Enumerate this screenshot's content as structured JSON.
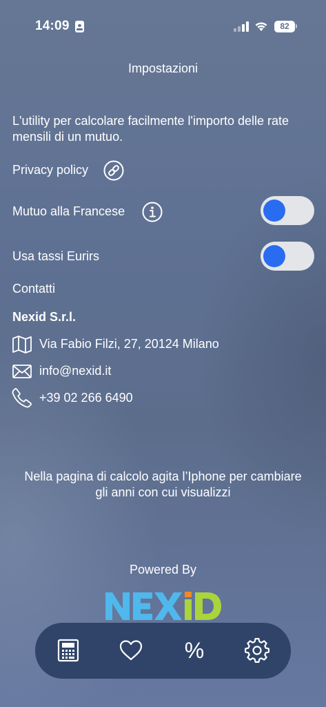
{
  "status_bar": {
    "time": "14:09",
    "battery": "82"
  },
  "header": {
    "title": "Impostazioni"
  },
  "description": "L'utility per calcolare facilmente l'importo delle rate mensili di un mutuo.",
  "settings": {
    "privacy_label": "Privacy policy",
    "francese_label": "Mutuo alla Francese",
    "francese_on": true,
    "eurirs_label": "Usa tassi Eurirs",
    "eurirs_on": true
  },
  "contacts": {
    "title": "Contatti",
    "company": "Nexid S.r.l.",
    "address": "Via Fabio Filzi, 27, 20124 Milano",
    "email": "info@nexid.it",
    "phone": "+39 02 266 6490"
  },
  "hint": "Nella pagina di calcolo agita l’Iphone per cambiare gli anni con cui visualizzi",
  "footer": {
    "powered_by": "Powered By",
    "logo_text": "NEXiD"
  },
  "tabbar": {
    "icons": [
      "calculator-icon",
      "heart-icon",
      "percent-icon",
      "gear-icon"
    ],
    "percent_glyph": "%"
  },
  "colors": {
    "accent": "#2a6cf0",
    "tabbar": "#2f4468",
    "logo_blue": "#4fb8ec",
    "logo_green": "#a9d43c",
    "logo_orange": "#f08a24"
  }
}
